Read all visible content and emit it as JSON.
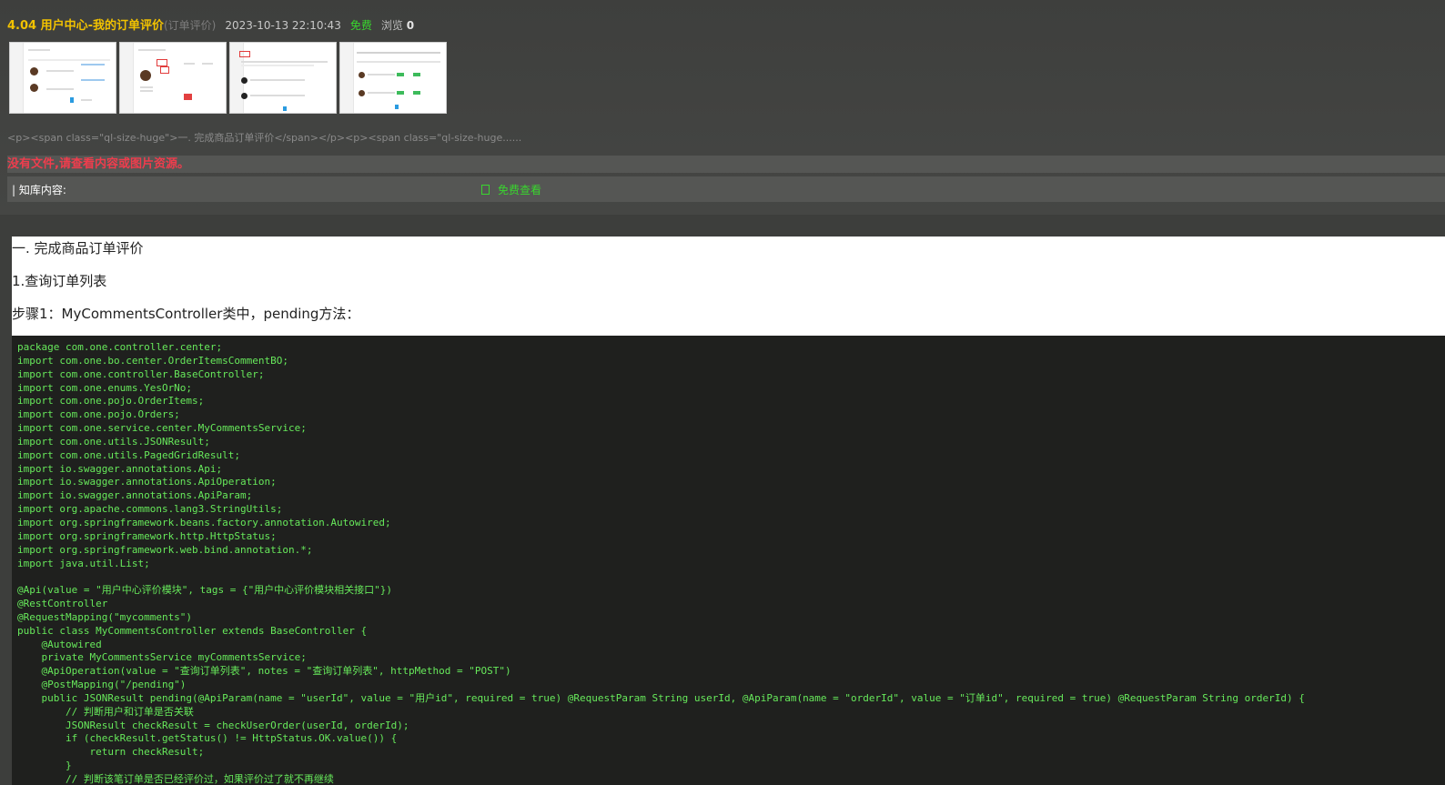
{
  "header": {
    "title": "4.04 用户中心-我的订单评价",
    "subtitle": "(订单评价)",
    "date": "2023-10-13 22:10:43",
    "price": "免费",
    "views_label": "浏览",
    "views_count": "0"
  },
  "thumbnails": [
    {
      "name": "thumbnail-1"
    },
    {
      "name": "thumbnail-2"
    },
    {
      "name": "thumbnail-3"
    },
    {
      "name": "thumbnail-4"
    }
  ],
  "excerpt": "<p><span class=\"ql-size-huge\">一. 完成商品订单评价</span></p><p><span class=\"ql-size-huge......",
  "notice": "没有文件,请查看内容或图片资源。",
  "knowledge": {
    "label": "| 知库内容:",
    "view_button": "免费查看"
  },
  "article": {
    "heading": "一. 完成商品订单评价",
    "section": "1.查询订单列表",
    "step": "步骤1：MyCommentsController类中，pending方法："
  },
  "code": "package com.one.controller.center;\nimport com.one.bo.center.OrderItemsCommentBO;\nimport com.one.controller.BaseController;\nimport com.one.enums.YesOrNo;\nimport com.one.pojo.OrderItems;\nimport com.one.pojo.Orders;\nimport com.one.service.center.MyCommentsService;\nimport com.one.utils.JSONResult;\nimport com.one.utils.PagedGridResult;\nimport io.swagger.annotations.Api;\nimport io.swagger.annotations.ApiOperation;\nimport io.swagger.annotations.ApiParam;\nimport org.apache.commons.lang3.StringUtils;\nimport org.springframework.beans.factory.annotation.Autowired;\nimport org.springframework.http.HttpStatus;\nimport org.springframework.web.bind.annotation.*;\nimport java.util.List;\n\n@Api(value = \"用户中心评价模块\", tags = {\"用户中心评价模块相关接口\"})\n@RestController\n@RequestMapping(\"mycomments\")\npublic class MyCommentsController extends BaseController {\n    @Autowired\n    private MyCommentsService myCommentsService;\n    @ApiOperation(value = \"查询订单列表\", notes = \"查询订单列表\", httpMethod = \"POST\")\n    @PostMapping(\"/pending\")\n    public JSONResult pending(@ApiParam(name = \"userId\", value = \"用户id\", required = true) @RequestParam String userId, @ApiParam(name = \"orderId\", value = \"订单id\", required = true) @RequestParam String orderId) {\n        // 判断用户和订单是否关联\n        JSONResult checkResult = checkUserOrder(userId, orderId);\n        if (checkResult.getStatus() != HttpStatus.OK.value()) {\n            return checkResult;\n        }\n        // 判断该笔订单是否已经评价过，如果评价过了就不再继续"
}
